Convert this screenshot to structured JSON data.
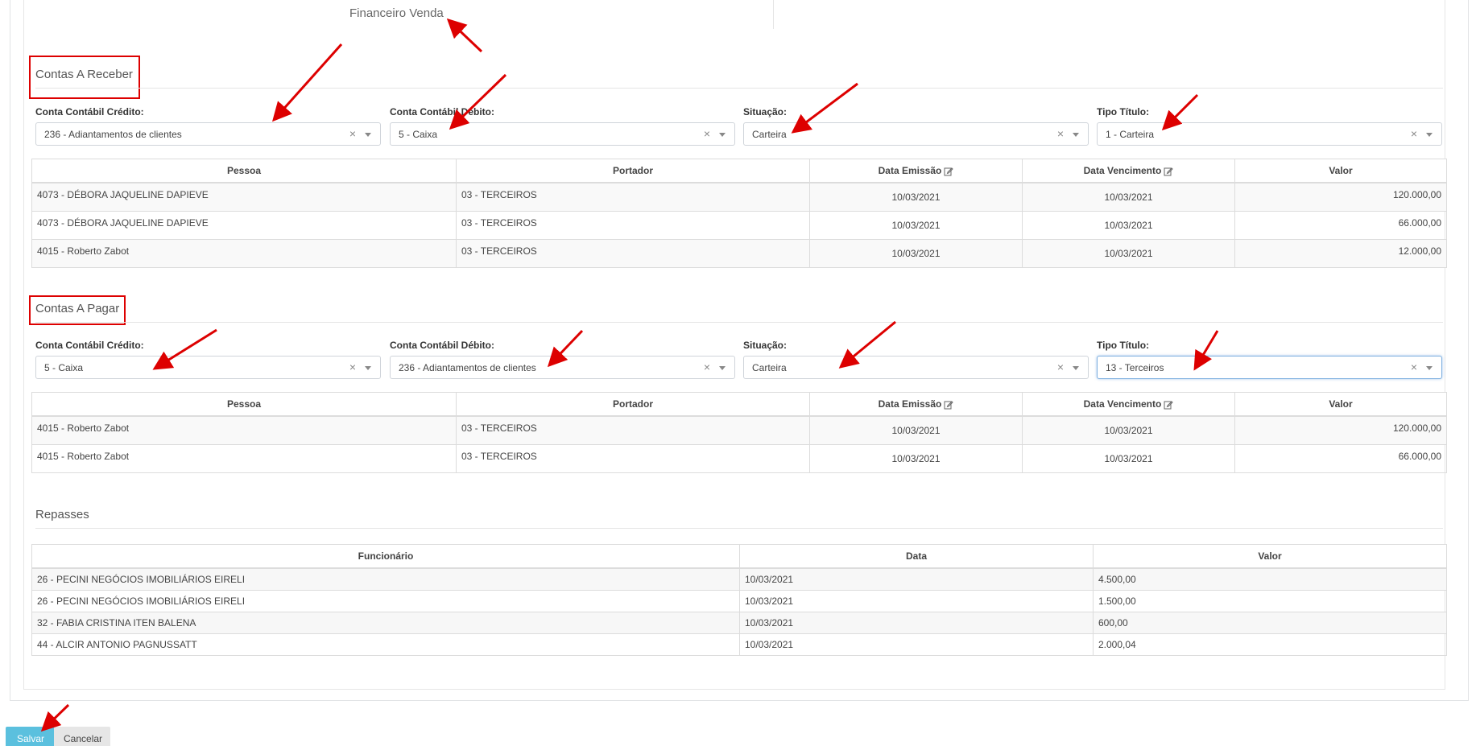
{
  "page": {
    "subtitle": "Financeiro Venda"
  },
  "receber": {
    "title": "Contas A Receber",
    "fields": [
      {
        "label": "Conta Contábil Crédito:",
        "value": "236 - Adiantamentos de clientes"
      },
      {
        "label": "Conta Contábil Débito:",
        "value": "5 - Caixa"
      },
      {
        "label": "Situação:",
        "value": "Carteira"
      },
      {
        "label": "Tipo Título:",
        "value": "1 - Carteira"
      }
    ],
    "columns": [
      "Pessoa",
      "Portador",
      "Data Emissão",
      "Data Vencimento",
      "Valor"
    ],
    "rows": [
      {
        "pessoa": "4073 - DÉBORA JAQUELINE DAPIEVE",
        "portador": "03 - TERCEIROS",
        "emissao": "10/03/2021",
        "vencimento": "10/03/2021",
        "valor": "120.000,00"
      },
      {
        "pessoa": "4073 - DÉBORA JAQUELINE DAPIEVE",
        "portador": "03 - TERCEIROS",
        "emissao": "10/03/2021",
        "vencimento": "10/03/2021",
        "valor": "66.000,00"
      },
      {
        "pessoa": "4015 - Roberto Zabot",
        "portador": "03 - TERCEIROS",
        "emissao": "10/03/2021",
        "vencimento": "10/03/2021",
        "valor": "12.000,00"
      }
    ]
  },
  "pagar": {
    "title": "Contas A Pagar",
    "fields": [
      {
        "label": "Conta Contábil Crédito:",
        "value": "5 - Caixa"
      },
      {
        "label": "Conta Contábil Débito:",
        "value": "236 - Adiantamentos de clientes"
      },
      {
        "label": "Situação:",
        "value": "Carteira"
      },
      {
        "label": "Tipo Título:",
        "value": "13 - Terceiros"
      }
    ],
    "columns": [
      "Pessoa",
      "Portador",
      "Data Emissão",
      "Data Vencimento",
      "Valor"
    ],
    "rows": [
      {
        "pessoa": "4015 - Roberto Zabot",
        "portador": "03 - TERCEIROS",
        "emissao": "10/03/2021",
        "vencimento": "10/03/2021",
        "valor": "120.000,00"
      },
      {
        "pessoa": "4015 - Roberto Zabot",
        "portador": "03 - TERCEIROS",
        "emissao": "10/03/2021",
        "vencimento": "10/03/2021",
        "valor": "66.000,00"
      }
    ]
  },
  "repasses": {
    "title": "Repasses",
    "columns": [
      "Funcionário",
      "Data",
      "Valor"
    ],
    "rows": [
      {
        "funcionario": "26 - PECINI NEGÓCIOS IMOBILIÁRIOS EIRELI",
        "data": "10/03/2021",
        "valor": "4.500,00"
      },
      {
        "funcionario": "26 - PECINI NEGÓCIOS IMOBILIÁRIOS EIRELI",
        "data": "10/03/2021",
        "valor": "1.500,00"
      },
      {
        "funcionario": "32 - FABIA CRISTINA ITEN BALENA",
        "data": "10/03/2021",
        "valor": "600,00"
      },
      {
        "funcionario": "44 - ALCIR ANTONIO PAGNUSSATT",
        "data": "10/03/2021",
        "valor": "2.000,04"
      }
    ]
  },
  "actions": {
    "save": "Salvar",
    "cancel": "Cancelar"
  },
  "icons": {
    "clear": "×",
    "edit": "edit-icon"
  },
  "colors": {
    "annotation": "#dd0000",
    "save_button": "#5bc0de",
    "focus_border": "#7fb0e0"
  }
}
